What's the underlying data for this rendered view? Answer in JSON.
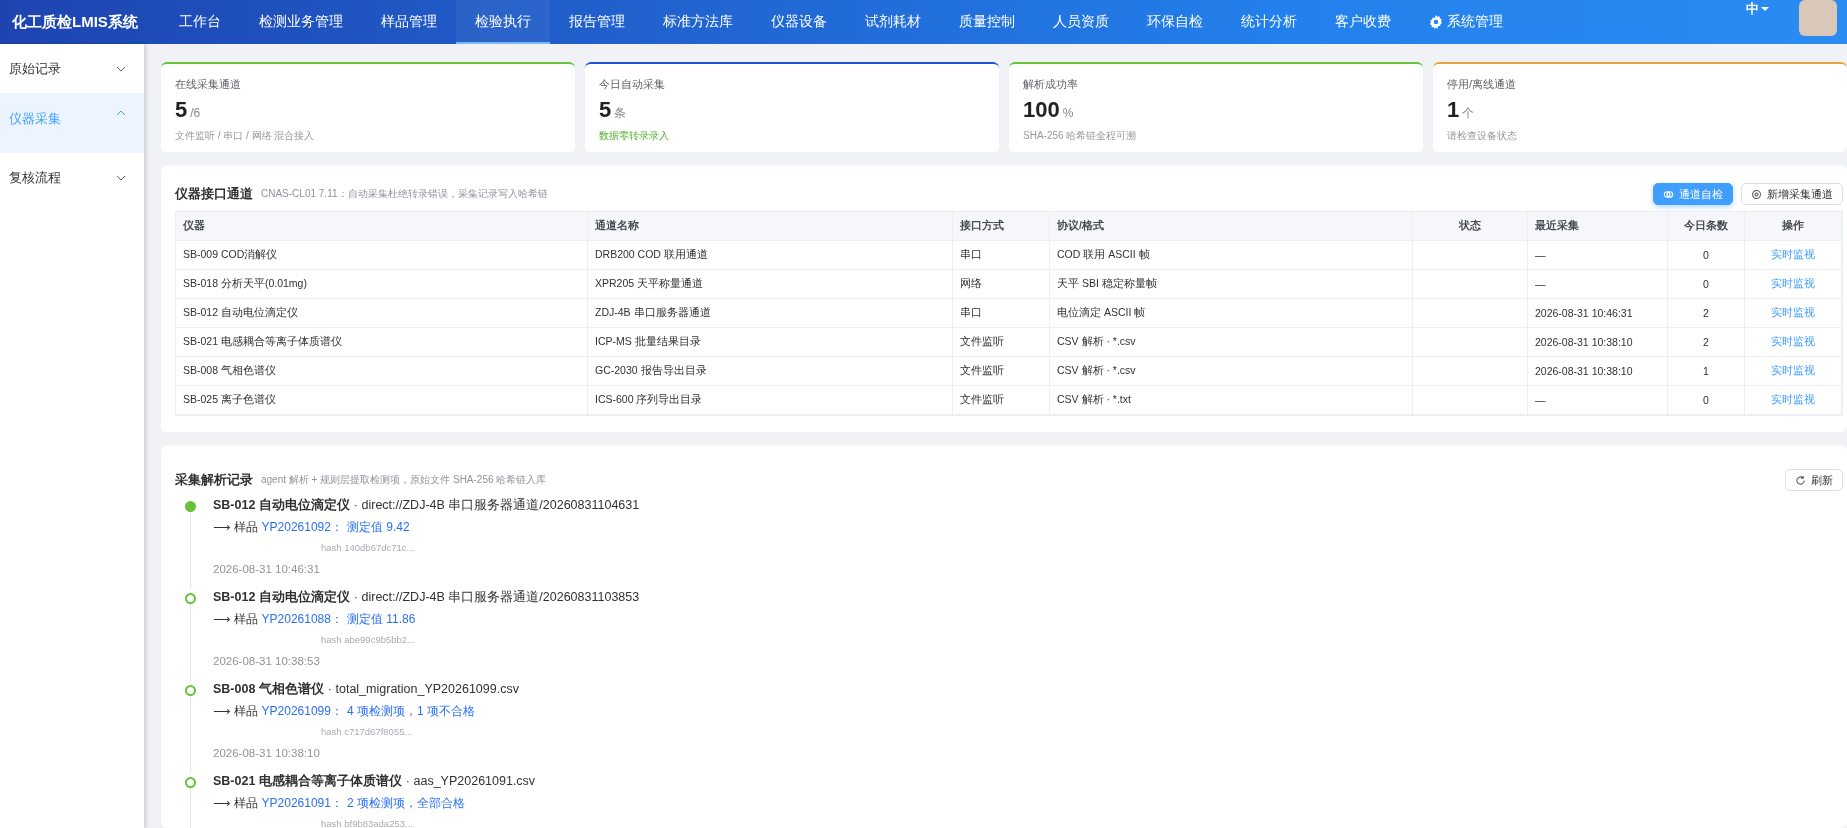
{
  "app": {
    "title": "化工质检LMIS系统",
    "language": "中"
  },
  "nav": [
    {
      "label": "工作台",
      "selected": false
    },
    {
      "label": "检测业务管理",
      "selected": false
    },
    {
      "label": "样品管理",
      "selected": false
    },
    {
      "label": "检验执行",
      "selected": true
    },
    {
      "label": "报告管理",
      "selected": false
    },
    {
      "label": "标准方法库",
      "selected": false
    },
    {
      "label": "仪器设备",
      "selected": false
    },
    {
      "label": "试剂耗材",
      "selected": false
    },
    {
      "label": "质量控制",
      "selected": false
    },
    {
      "label": "人员资质",
      "selected": false
    },
    {
      "label": "环保自检",
      "selected": false
    },
    {
      "label": "统计分析",
      "selected": false
    },
    {
      "label": "客户收费",
      "selected": false
    },
    {
      "label": "系统管理",
      "selected": false,
      "kind": "settings"
    }
  ],
  "sidebar": {
    "items": [
      {
        "label": "原始记录",
        "selected": false,
        "expanded": false
      },
      {
        "label": "仪器采集",
        "selected": true,
        "expanded": true
      },
      {
        "label": "复核流程",
        "selected": false,
        "expanded": false
      }
    ]
  },
  "stats": [
    {
      "label": "在线采集通道",
      "value": "5",
      "unit": "/6",
      "note": "文件监听 / 串口 / 网络 混合接入",
      "color": "#67c23a",
      "note_highlighted": false
    },
    {
      "label": "今日自动采集",
      "value": "5",
      "unit": "条",
      "note": "数据零转录录入",
      "color": "#1d4fd8",
      "note_highlighted": true
    },
    {
      "label": "解析成功率",
      "value": "100",
      "unit": "%",
      "note": "SHA-256 哈希链全程可溯",
      "color": "#67c23a",
      "note_highlighted": false
    },
    {
      "label": "停用/离线通道",
      "value": "1",
      "unit": "个",
      "note": "请检查设备状态",
      "color": "#e6a23c",
      "note_highlighted": false
    }
  ],
  "channels": {
    "title": "仪器接口通道",
    "subtitle": "CNAS-CL01 7.11：自动采集杜绝转录错误，采集记录写入哈希链",
    "buttons": [
      {
        "label": "通道自检",
        "kind": "primary"
      },
      {
        "label": "新增采集通道",
        "kind": "default"
      }
    ],
    "table": {
      "columns": [
        "仪器",
        "通道名称",
        "接口方式",
        "协议/格式",
        "状态",
        "最近采集",
        "今日条数",
        "操作"
      ],
      "rows": [
        [
          "SB-009 COD消解仪",
          "DRB200 COD 联用通道",
          "串口",
          "COD 联用 ASCII 帧",
          "",
          "—",
          "0",
          "实时监视"
        ],
        [
          "SB-018 分析天平(0.01mg)",
          "XPR205 天平称量通道",
          "网络",
          "天平 SBI 稳定称量帧",
          "",
          "—",
          "0",
          "实时监视"
        ],
        [
          "SB-012 自动电位滴定仪",
          "ZDJ-4B 串口服务器通道",
          "串口",
          "电位滴定 ASCII 帧",
          "",
          "2026-08-31 10:46:31",
          "2",
          "实时监视"
        ],
        [
          "SB-021 电感耦合等离子体质谱仪",
          "ICP-MS 批量结果目录",
          "文件监听",
          "CSV 解析 · *.csv",
          "",
          "2026-08-31 10:38:10",
          "2",
          "实时监视"
        ],
        [
          "SB-008 气相色谱仪",
          "GC-2030 报告导出目录",
          "文件监听",
          "CSV 解析 · *.csv",
          "",
          "2026-08-31 10:38:10",
          "1",
          "实时监视"
        ],
        [
          "SB-025 离子色谱仪",
          "ICS-600 序列导出目录",
          "文件监听",
          "CSV 解析 · *.txt",
          "",
          "—",
          "0",
          "实时监视"
        ]
      ]
    }
  },
  "records": {
    "title": "采集解析记录",
    "subtitle": "agent 解析 + 规则层提取检测项，原始文件 SHA-256 哈希链入库",
    "refresh": "刷新",
    "entries": [
      {
        "instrument": "SB-012 自动电位滴定仪",
        "source": "· direct://ZDJ-4B 串口服务器通道/20260831104631",
        "prefix": "⟶ 样品",
        "sample": "YP20261092：",
        "result": "测定值 9.42",
        "hash": "hash 140db67dc71c...",
        "time": "2026-08-31 10:46:31",
        "filled": true
      },
      {
        "instrument": "SB-012 自动电位滴定仪",
        "source": "· direct://ZDJ-4B 串口服务器通道/20260831103853",
        "prefix": "⟶ 样品",
        "sample": "YP20261088：",
        "result": "测定值 11.86",
        "hash": "hash abe99c9b5bb2...",
        "time": "2026-08-31 10:38:53",
        "filled": false
      },
      {
        "instrument": "SB-008 气相色谱仪",
        "source": "· total_migration_YP20261099.csv",
        "prefix": "⟶ 样品",
        "sample": "YP20261099：",
        "result": "4 项检测项，1 项不合格",
        "hash": "hash c717d67f8055...",
        "time": "2026-08-31 10:38:10",
        "filled": false
      },
      {
        "instrument": "SB-021 电感耦合等离子体质谱仪",
        "source": "· aas_YP20261091.csv",
        "prefix": "⟶ 样品",
        "sample": "YP20261091：",
        "result": "2 项检测项，全部合格",
        "hash": "hash bf9b83ada253...",
        "filled": false
      }
    ]
  }
}
